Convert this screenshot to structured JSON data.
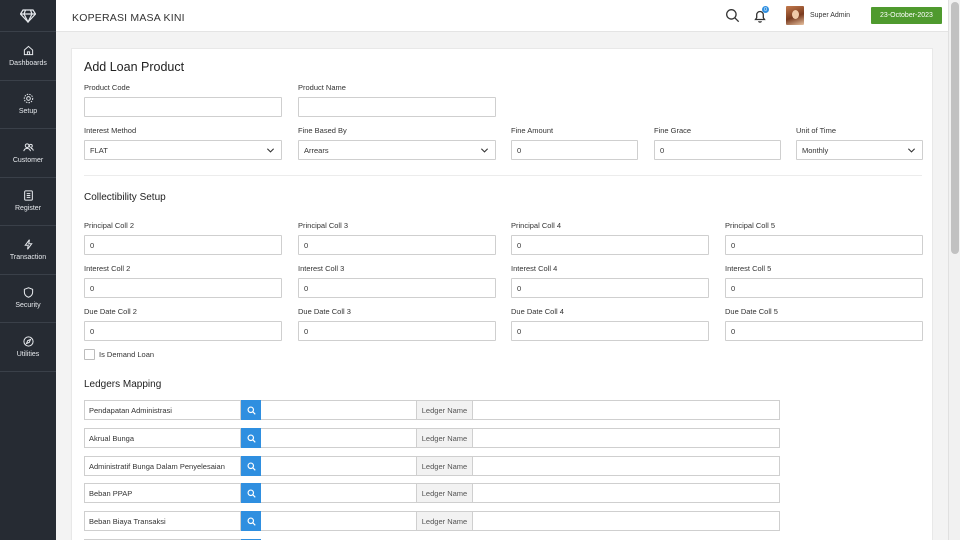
{
  "header": {
    "app_title": "KOPERASI MASA KINI",
    "notification_count": "0",
    "user_name": "Super Admin",
    "date": "23-October-2023"
  },
  "sidebar": {
    "items": [
      {
        "label": "Dashboards",
        "icon": "home-icon"
      },
      {
        "label": "Setup",
        "icon": "gear-icon"
      },
      {
        "label": "Customer",
        "icon": "users-icon"
      },
      {
        "label": "Register",
        "icon": "register-icon"
      },
      {
        "label": "Transaction",
        "icon": "lightning-icon"
      },
      {
        "label": "Security",
        "icon": "shield-icon"
      },
      {
        "label": "Utilities",
        "icon": "compass-icon"
      }
    ]
  },
  "form": {
    "title": "Add Loan Product",
    "product_code_label": "Product Code",
    "product_code_value": "",
    "product_name_label": "Product Name",
    "product_name_value": "",
    "interest_method_label": "Interest Method",
    "interest_method_value": "FLAT",
    "fine_based_by_label": "Fine Based By",
    "fine_based_by_value": "Arrears",
    "fine_amount_label": "Fine Amount",
    "fine_amount_value": "0",
    "fine_grace_label": "Fine Grace",
    "fine_grace_value": "0",
    "unit_of_time_label": "Unit of Time",
    "unit_of_time_value": "Monthly"
  },
  "collectibility": {
    "title": "Collectibility Setup",
    "principal": [
      {
        "label": "Principal Coll 2",
        "value": "0"
      },
      {
        "label": "Principal Coll 3",
        "value": "0"
      },
      {
        "label": "Principal Coll 4",
        "value": "0"
      },
      {
        "label": "Principal Coll 5",
        "value": "0"
      }
    ],
    "interest": [
      {
        "label": "Interest Coll 2",
        "value": "0"
      },
      {
        "label": "Interest Coll 3",
        "value": "0"
      },
      {
        "label": "Interest Coll 4",
        "value": "0"
      },
      {
        "label": "Interest Coll 5",
        "value": "0"
      }
    ],
    "due_date": [
      {
        "label": "Due Date Coll 2",
        "value": "0"
      },
      {
        "label": "Due Date Coll 3",
        "value": "0"
      },
      {
        "label": "Due Date Coll 4",
        "value": "0"
      },
      {
        "label": "Due Date Coll 5",
        "value": "0"
      }
    ],
    "demand_loan_label": "Is Demand Loan",
    "demand_loan_checked": false
  },
  "ledgers": {
    "title": "Ledgers Mapping",
    "ledger_tag": "Ledger Name",
    "rows": [
      {
        "name": "Pendapatan Administrasi"
      },
      {
        "name": "Akrual Bunga"
      },
      {
        "name": "Administratif Bunga Dalam Penyelesaian"
      },
      {
        "name": "Beban PPAP"
      },
      {
        "name": "Beban Biaya Transaksi"
      }
    ]
  },
  "colors": {
    "sidebar": "#262b33",
    "accent_blue": "#2f8fe0",
    "date_green": "#4f9a2e"
  }
}
